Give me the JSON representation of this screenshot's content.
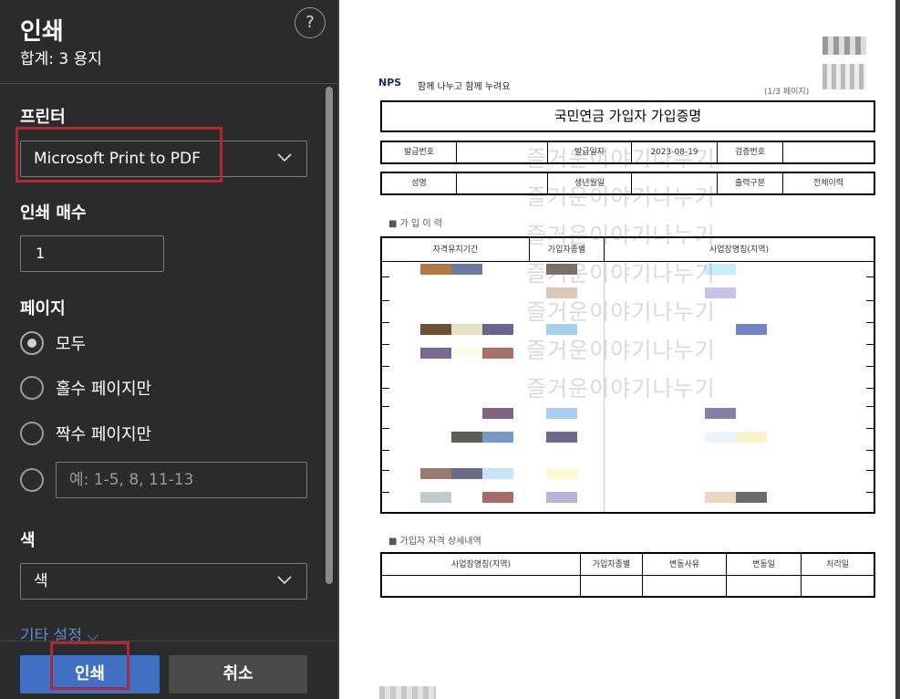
{
  "panel": {
    "title": "인쇄",
    "summary": "합계: 3 용지",
    "help_glyph": "?",
    "printer": {
      "label": "프린터",
      "selected": "Microsoft Print to PDF"
    },
    "copies": {
      "label": "인쇄 매수",
      "value": "1"
    },
    "pages": {
      "label": "페이지",
      "options": [
        "모두",
        "홀수 페이지만",
        "짝수 페이지만"
      ],
      "selected": "모두",
      "custom_placeholder": "예: 1-5, 8, 11-13"
    },
    "color": {
      "label": "색",
      "selected": "색"
    },
    "more_settings": "기타 설정 ⌵",
    "print_button": "인쇄",
    "cancel_button": "취소"
  },
  "document": {
    "logo": "NPS",
    "tagline": "함께 나누고 함께 누려요",
    "page_info": "(1/3 페이지)",
    "title": "국민연금 가입자 가입증명",
    "info_row1": {
      "issue_no_label": "발급번호",
      "issue_date_label": "발급일자",
      "issue_date": "2023-08-19",
      "verify_no_label": "검증번호"
    },
    "info_row2": {
      "name_label": "성명",
      "birth_label": "생년월일",
      "output_type_label": "출력구분",
      "output_type": "전체이력"
    },
    "history_title": "■ 가 입 이 력",
    "history_headers": [
      "자격유지기간",
      "가입자종별",
      "사업장명칭(지역)"
    ],
    "detail_title": "■ 가입자 자격 상세내역",
    "detail_headers": [
      "사업장명칭(지역)",
      "가입자종별",
      "변동사유",
      "변동일",
      "처리일"
    ],
    "watermark": "즐거운이야기나누기"
  },
  "colors": {
    "accent": "#4070c4",
    "highlight": "#e0141c",
    "panel_bg": "#2b2b2b"
  }
}
